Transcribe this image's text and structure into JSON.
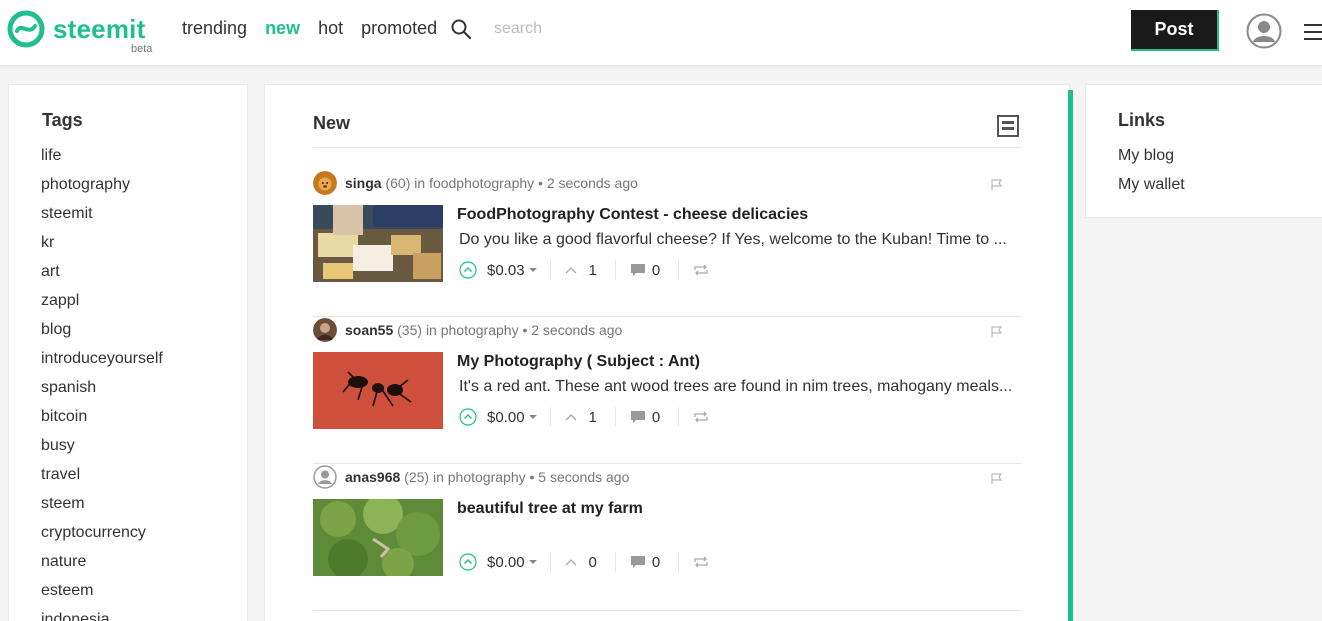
{
  "header": {
    "logo_text": "steemit",
    "logo_badge": "beta",
    "nav": [
      "trending",
      "new",
      "hot",
      "promoted"
    ],
    "active_nav": "new",
    "search_placeholder": "search",
    "post_button": "Post",
    "accent_color": "#1fbf8f"
  },
  "sidebar": {
    "title": "Tags",
    "tags": [
      "life",
      "photography",
      "steemit",
      "kr",
      "art",
      "zappl",
      "blog",
      "introduceyourself",
      "spanish",
      "bitcoin",
      "busy",
      "travel",
      "steem",
      "cryptocurrency",
      "nature",
      "esteem",
      "indonesia"
    ]
  },
  "main": {
    "title": "New",
    "posts": [
      {
        "author": "singa",
        "reputation": "(60)",
        "in_text": "in",
        "category": "foodphotography",
        "time": "• 2 seconds ago",
        "title": "FoodPhotography Contest - cheese delicacies",
        "excerpt": "Do you like a good flavorful cheese? If Yes, welcome to the Kuban! Time to ...",
        "payout": "$0.03",
        "votes": "1",
        "comments": "0"
      },
      {
        "author": "soan55",
        "reputation": "(35)",
        "in_text": "in",
        "category": "photography",
        "time": "• 2 seconds ago",
        "title": "My Photography ( Subject : Ant)",
        "excerpt": "It's a red ant. These ant wood trees are found in nim trees, mahogany meals...",
        "payout": "$0.00",
        "votes": "1",
        "comments": "0"
      },
      {
        "author": "anas968",
        "reputation": "(25)",
        "in_text": "in",
        "category": "photography",
        "time": "• 5 seconds ago",
        "title": "beautiful tree at my farm",
        "excerpt": "",
        "payout": "$0.00",
        "votes": "0",
        "comments": "0"
      }
    ]
  },
  "links": {
    "title": "Links",
    "items": [
      "My blog",
      "My wallet"
    ]
  }
}
